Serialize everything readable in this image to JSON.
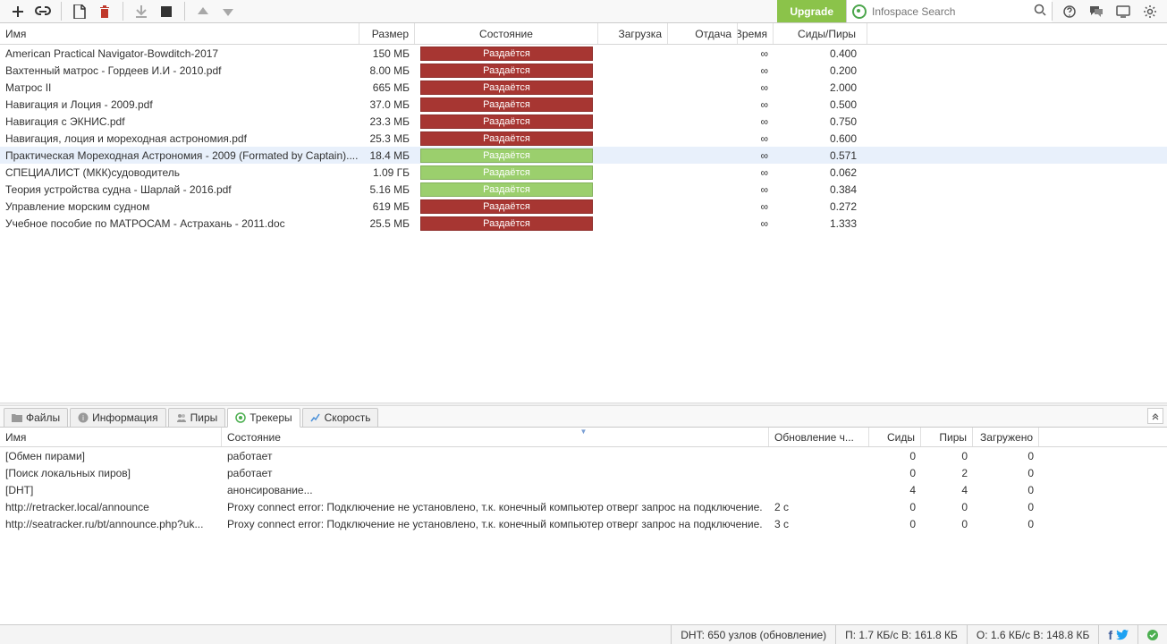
{
  "toolbar": {
    "upgrade": "Upgrade",
    "search_placeholder": "Infospace Search"
  },
  "columns": {
    "name": "Имя",
    "size": "Размер",
    "state": "Состояние",
    "download": "Загрузка",
    "upload": "Отдача",
    "time": "Время",
    "ratio": "Сиды/Пиры"
  },
  "torrents": [
    {
      "name": "American Practical Navigator-Bowditch-2017",
      "size": "150 МБ",
      "state": "Раздаётся",
      "green": false,
      "time": "∞",
      "ratio": "0.400",
      "sel": false
    },
    {
      "name": "Вахтенный матрос - Гордеев И.И - 2010.pdf",
      "size": "8.00 МБ",
      "state": "Раздаётся",
      "green": false,
      "time": "∞",
      "ratio": "0.200",
      "sel": false
    },
    {
      "name": "Матрос II",
      "size": "665 МБ",
      "state": "Раздаётся",
      "green": false,
      "time": "∞",
      "ratio": "2.000",
      "sel": false
    },
    {
      "name": "Навигация и Лоция - 2009.pdf",
      "size": "37.0 МБ",
      "state": "Раздаётся",
      "green": false,
      "time": "∞",
      "ratio": "0.500",
      "sel": false
    },
    {
      "name": "Навигация с ЭКНИС.pdf",
      "size": "23.3 МБ",
      "state": "Раздаётся",
      "green": false,
      "time": "∞",
      "ratio": "0.750",
      "sel": false
    },
    {
      "name": "Навигация, лоция и мореходная астрономия.pdf",
      "size": "25.3 МБ",
      "state": "Раздаётся",
      "green": false,
      "time": "∞",
      "ratio": "0.600",
      "sel": false
    },
    {
      "name": "Практическая Мореходная Астрономия - 2009 (Formated by Captain)....",
      "size": "18.4 МБ",
      "state": "Раздаётся",
      "green": true,
      "time": "∞",
      "ratio": "0.571",
      "sel": true
    },
    {
      "name": "СПЕЦИАЛИСТ  (МКК)судоводитель",
      "size": "1.09 ГБ",
      "state": "Раздаётся",
      "green": true,
      "time": "∞",
      "ratio": "0.062",
      "sel": false
    },
    {
      "name": "Теория устройства судна - Шарлай - 2016.pdf",
      "size": "5.16 МБ",
      "state": "Раздаётся",
      "green": true,
      "time": "∞",
      "ratio": "0.384",
      "sel": false
    },
    {
      "name": "Управление морским судном",
      "size": "619 МБ",
      "state": "Раздаётся",
      "green": false,
      "time": "∞",
      "ratio": "0.272",
      "sel": false
    },
    {
      "name": "Учебное пособие по МАТРОСАМ - Астрахань - 2011.doc",
      "size": "25.5 МБ",
      "state": "Раздаётся",
      "green": false,
      "time": "∞",
      "ratio": "1.333",
      "sel": false
    }
  ],
  "detail_tabs": {
    "files": "Файлы",
    "info": "Информация",
    "peers": "Пиры",
    "trackers": "Трекеры",
    "speed": "Скорость"
  },
  "tracker_columns": {
    "name": "Имя",
    "state": "Состояние",
    "update": "Обновление ч...",
    "seeds": "Сиды",
    "peers": "Пиры",
    "downloaded": "Загружено"
  },
  "trackers": [
    {
      "name": "[Обмен пирами]",
      "state": "работает",
      "update": "",
      "seeds": "0",
      "peers": "0",
      "dl": "0"
    },
    {
      "name": "[Поиск локальных пиров]",
      "state": "работает",
      "update": "",
      "seeds": "0",
      "peers": "2",
      "dl": "0"
    },
    {
      "name": "[DHT]",
      "state": "анонсирование...",
      "update": "",
      "seeds": "4",
      "peers": "4",
      "dl": "0"
    },
    {
      "name": "http://retracker.local/announce",
      "state": "Proxy connect error: Подключение не установлено, т.к. конечный компьютер отверг запрос на подключение.",
      "update": "2 с",
      "seeds": "0",
      "peers": "0",
      "dl": "0"
    },
    {
      "name": "http://seatracker.ru/bt/announce.php?uk...",
      "state": "Proxy connect error: Подключение не установлено, т.к. конечный компьютер отверг запрос на подключение.",
      "update": "3 с",
      "seeds": "0",
      "peers": "0",
      "dl": "0"
    }
  ],
  "status": {
    "dht": "DHT: 650 узлов  (обновление)",
    "dl": "П: 1.7 КБ/с В: 161.8 КБ",
    "ul": "О: 1.6 КБ/с В: 148.8 КБ"
  }
}
